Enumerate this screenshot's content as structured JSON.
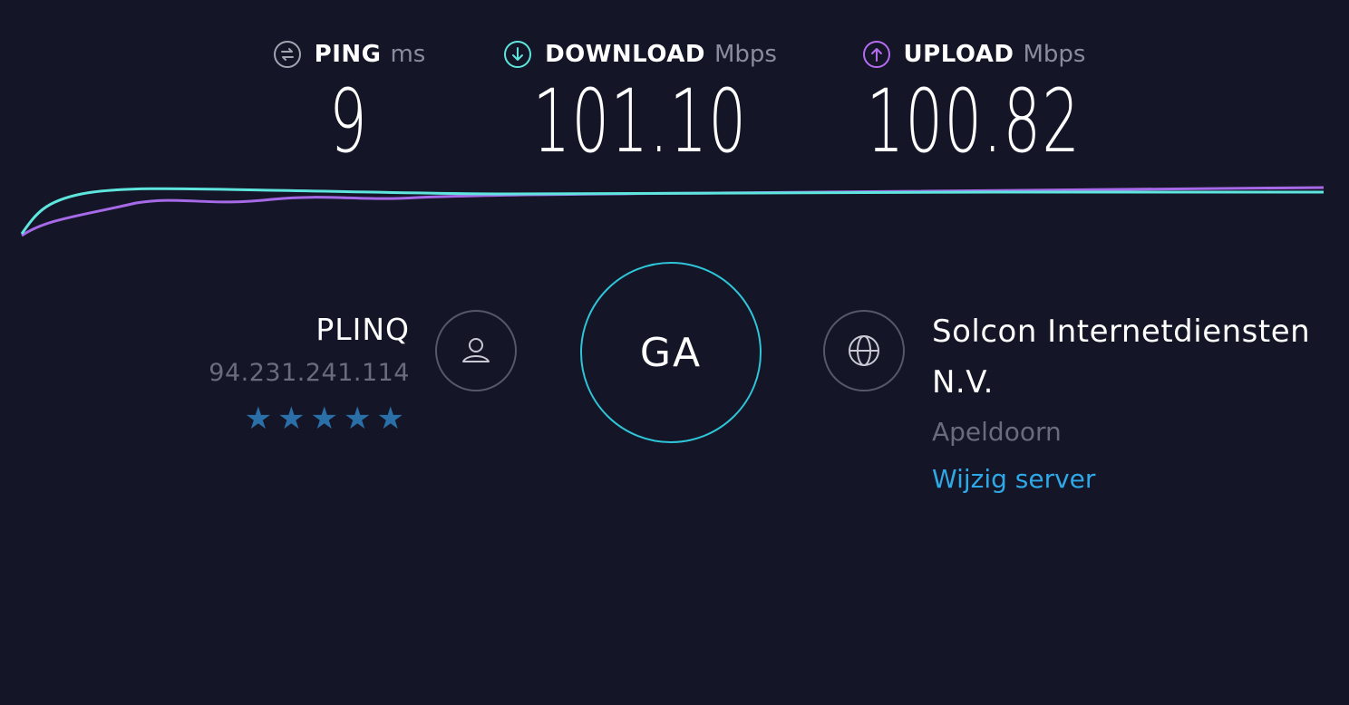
{
  "metrics": {
    "ping": {
      "label": "PING",
      "unit": "ms",
      "value": "9",
      "icon": "ping-icon",
      "color": "#a3a4b2"
    },
    "download": {
      "label": "DOWNLOAD",
      "unit": "Mbps",
      "value": "101.10",
      "icon": "download-arrow-icon",
      "color": "#5ee6de"
    },
    "upload": {
      "label": "UPLOAD",
      "unit": "Mbps",
      "value": "100.82",
      "icon": "upload-arrow-icon",
      "color": "#b46cf0"
    }
  },
  "graph": {
    "download_color": "#5ee6de",
    "upload_color": "#a66ae8"
  },
  "isp": {
    "name": "PLINQ",
    "ip": "94.231.241.114",
    "rating_stars": 5,
    "stars": "★★★★★",
    "icon": "user-icon"
  },
  "go_button": {
    "label": "GA",
    "border_color": "#2ec5d8"
  },
  "server": {
    "name": "Solcon Internetdiensten N.V.",
    "location": "Apeldoorn",
    "change_label": "Wijzig server",
    "icon": "globe-icon",
    "link_color": "#2fa8e8"
  },
  "colors": {
    "background": "#141526",
    "text": "#ffffff",
    "muted": "#6a6b7c"
  }
}
